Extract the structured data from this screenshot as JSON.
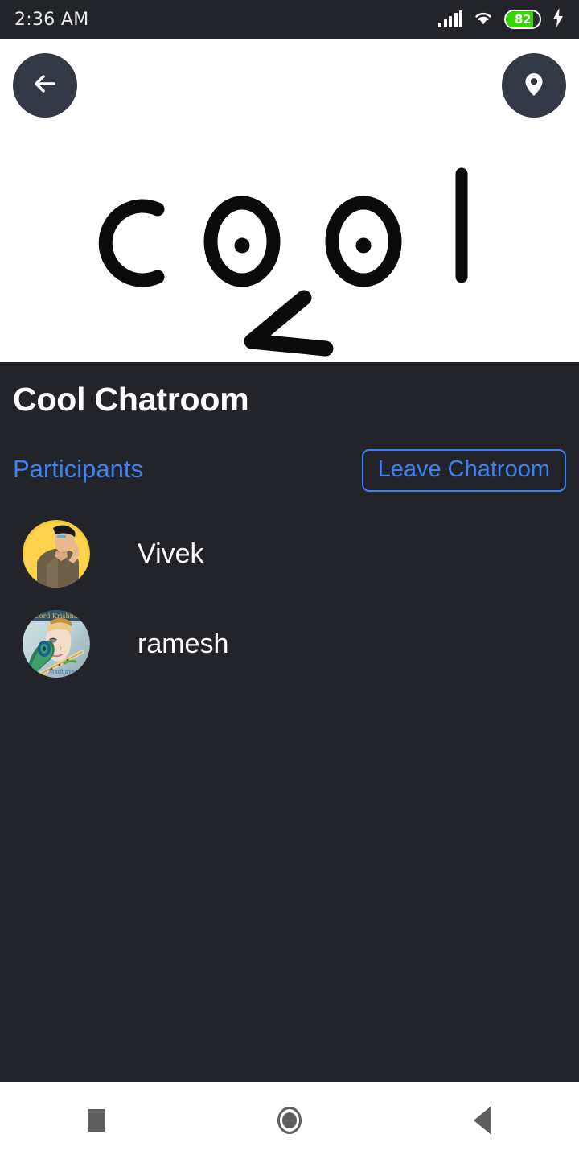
{
  "status_bar": {
    "time": "2:36 AM",
    "battery_percent": "82",
    "icons": [
      "signal-bars-icon",
      "wifi-icon",
      "battery-icon",
      "charging-bolt-icon"
    ]
  },
  "hero": {
    "back_button_icon": "arrow-left-icon",
    "location_button_icon": "map-pin-icon",
    "drawing_text": "cool",
    "background_color": "#ffffff",
    "ink_color": "#000000"
  },
  "room": {
    "title": "Cool Chatroom",
    "participants_label": "Participants",
    "leave_label": "Leave Chatroom",
    "accent_color": "#3b82f6",
    "background_color": "#222429"
  },
  "participants": [
    {
      "name": "Vivek",
      "avatar": "anime-character-avatar"
    },
    {
      "name": "ramesh",
      "avatar": "krishna-illustration-avatar"
    }
  ],
  "nav_bar": {
    "recents_icon": "square-icon",
    "home_icon": "circle-icon",
    "back_icon": "triangle-left-icon"
  }
}
